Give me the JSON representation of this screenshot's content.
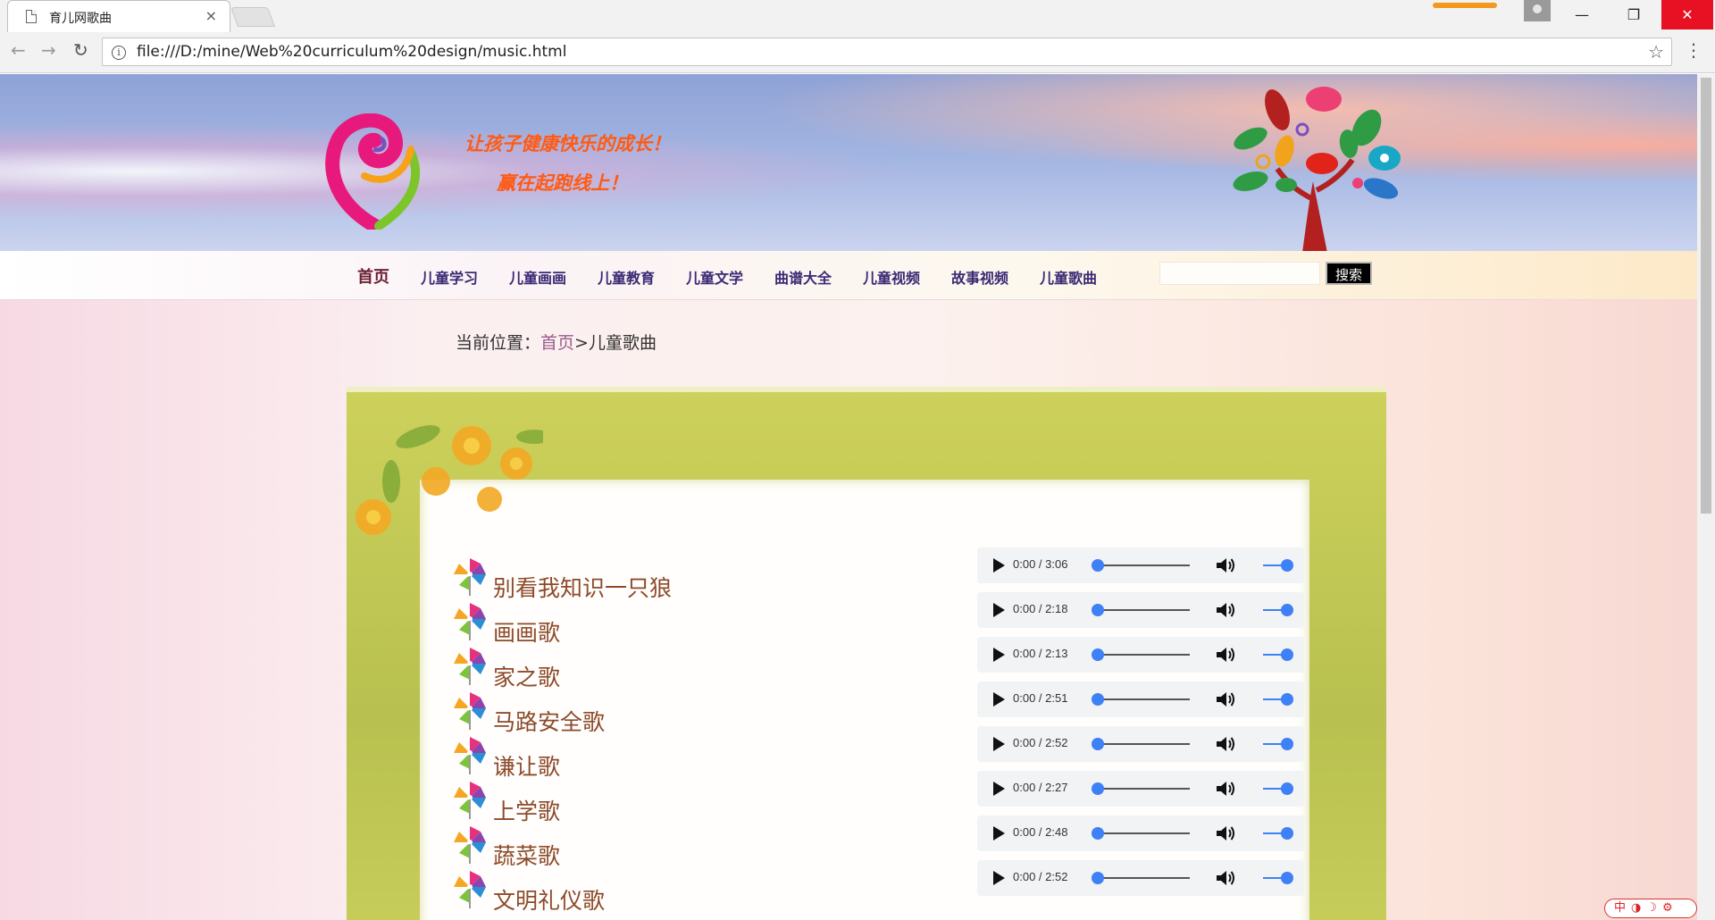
{
  "browser": {
    "tab_title": "育儿网歌曲",
    "tab_close": "×",
    "url": "file:///D:/mine/Web%20curriculum%20design/music.html",
    "window_min": "—",
    "window_max": "❐",
    "window_close": "✕"
  },
  "header": {
    "slogan_line1": "让孩子健康快乐的成长！",
    "slogan_line2": "赢在起跑线上！"
  },
  "nav": {
    "items": [
      "首页",
      "儿童学习",
      "儿童画画",
      "儿童教育",
      "儿童文学",
      "曲谱大全",
      "儿童视频",
      "故事视频",
      "儿童歌曲"
    ],
    "search_placeholder": "",
    "search_button": "搜索"
  },
  "breadcrumb": {
    "prefix": "当前位置：",
    "home": "首页",
    "separator": ">",
    "current": "儿童歌曲"
  },
  "songs": [
    {
      "title": "别看我知识一只狼",
      "time": "0:00 / 3:06"
    },
    {
      "title": "画画歌",
      "time": "0:00 / 2:18"
    },
    {
      "title": "家之歌",
      "time": "0:00 / 2:13"
    },
    {
      "title": "马路安全歌",
      "time": "0:00 / 2:51"
    },
    {
      "title": "谦让歌",
      "time": "0:00 / 2:52"
    },
    {
      "title": "上学歌",
      "time": "0:00 / 2:27"
    },
    {
      "title": "蔬菜歌",
      "time": "0:00 / 2:48"
    },
    {
      "title": "文明礼仪歌",
      "time": "0:00 / 2:52"
    }
  ],
  "player": {
    "progress": 0,
    "volume": 1.0
  },
  "icons": {
    "play": "play-icon",
    "volume": "volume-icon",
    "song_bullet": "windmill-icon"
  },
  "colors": {
    "slogan": "#ff5a14",
    "nav_text": "#3b2a74",
    "song_title": "#8d4a2a",
    "player_accent": "#3e80f5",
    "frame": "#c4ca55"
  }
}
